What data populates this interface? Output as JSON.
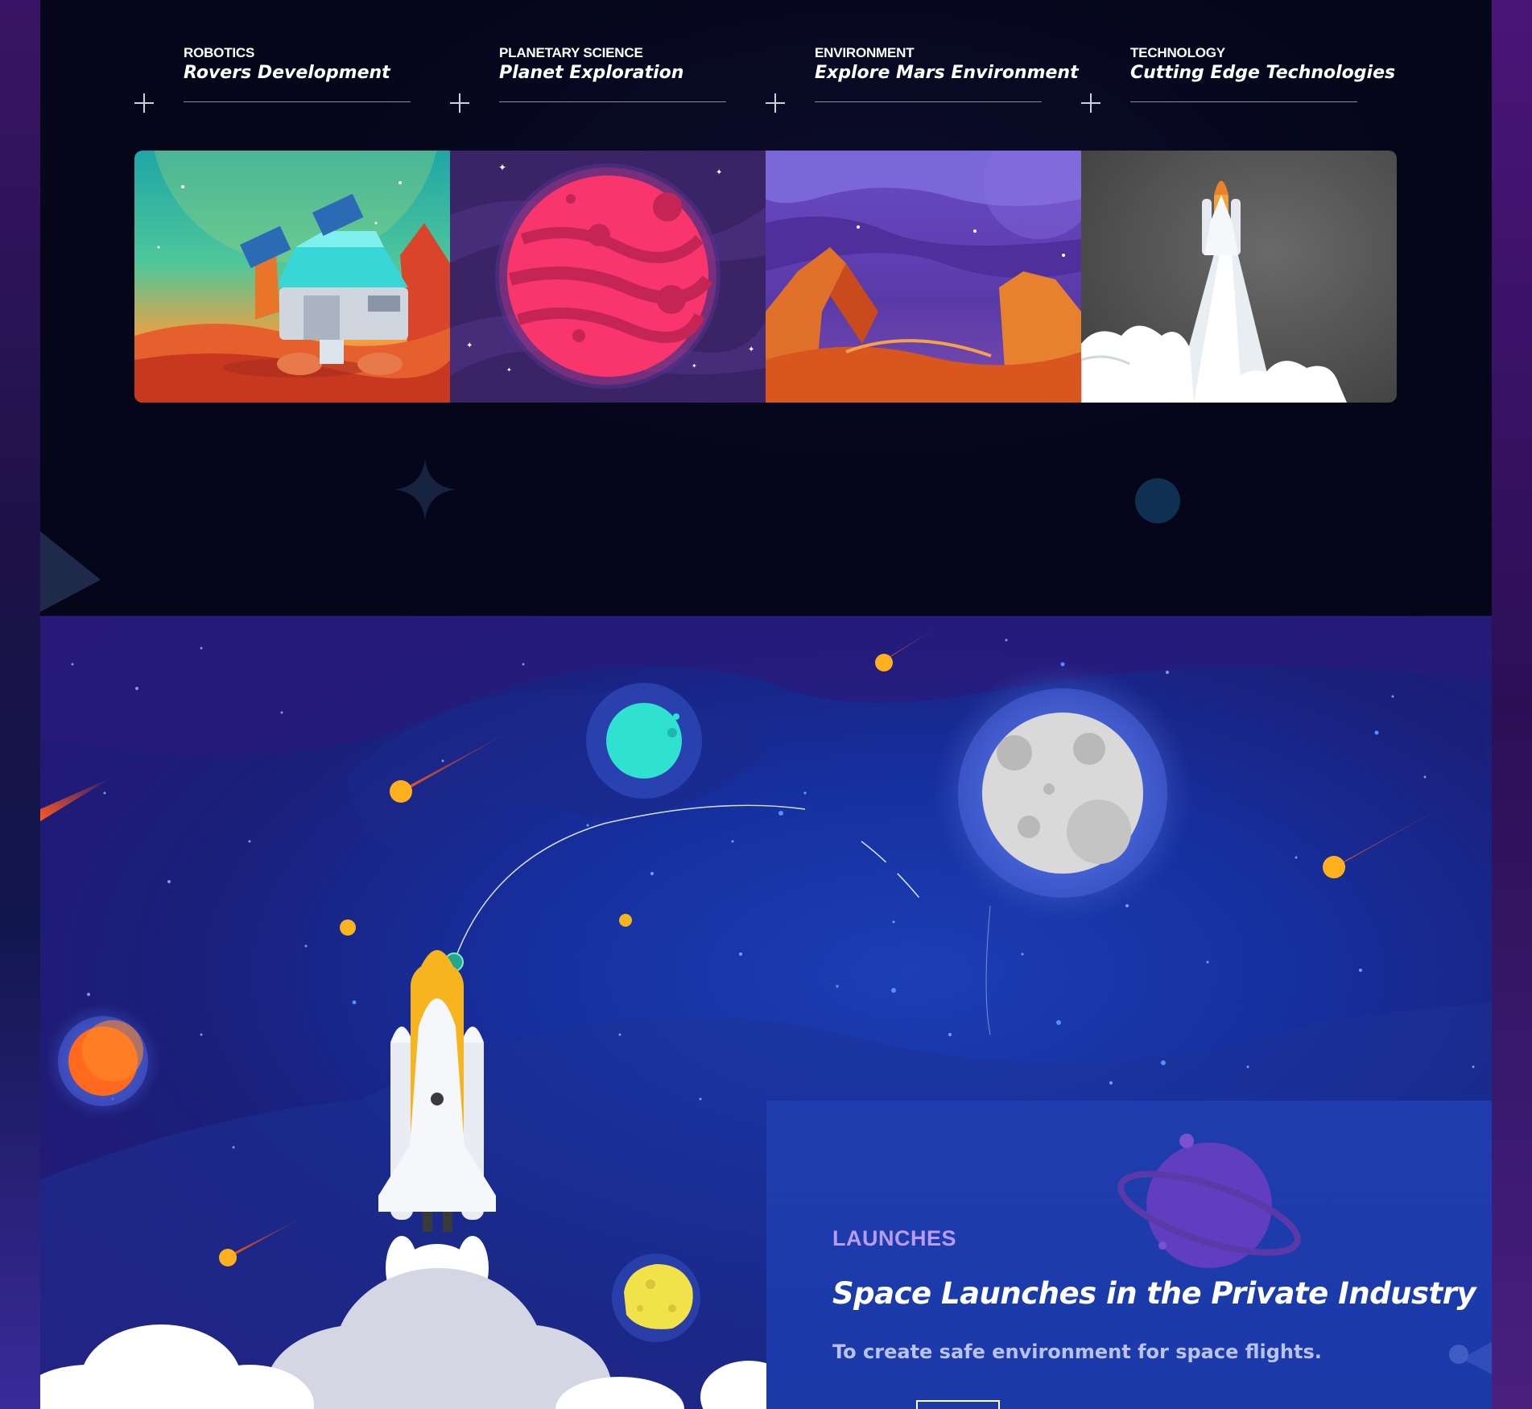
{
  "categories": [
    {
      "kicker": "ROBOTICS",
      "title": "Rovers Development",
      "image": "lunar-base-illustration"
    },
    {
      "kicker": "PLANETARY SCIENCE",
      "title": "Planet Exploration",
      "image": "red-planet-illustration"
    },
    {
      "kicker": "ENVIRONMENT",
      "title": "Explore Mars Environment",
      "image": "mars-canyon-illustration"
    },
    {
      "kicker": "TECHNOLOGY",
      "title": "Cutting Edge Technologies",
      "image": "shuttle-launch-illustration"
    }
  ],
  "launches": {
    "kicker": "LAUNCHES",
    "heading": "Space Launches in the Private Industry",
    "subtitle": "To create safe environment for space flights."
  },
  "colors": {
    "top_background": "#05061a",
    "accent_purple": "#b79cf0",
    "card_blue": "#1f3cae"
  }
}
